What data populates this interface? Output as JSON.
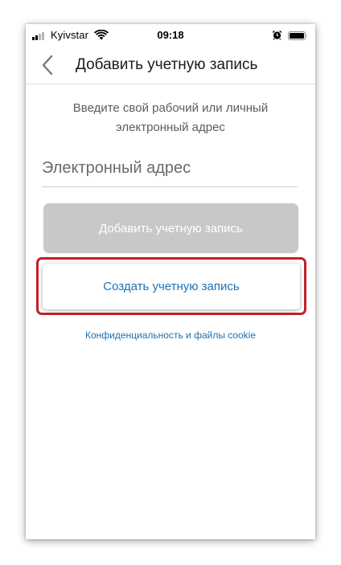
{
  "status_bar": {
    "carrier": "Kyivstar",
    "time": "09:18"
  },
  "nav": {
    "title": "Добавить учетную запись"
  },
  "content": {
    "subtitle": "Введите свой рабочий или личный электронный адрес",
    "email_placeholder": "Электронный адрес",
    "add_button_label": "Добавить учетную запись",
    "create_button_label": "Создать учетную запись",
    "privacy_link": "Конфиденциальность и файлы cookie"
  },
  "colors": {
    "accent": "#1a72b8",
    "disabled_button": "#c8c8c8",
    "highlight_border": "#c12127"
  },
  "icons": {
    "back": "chevron-left-icon",
    "signal": "cell-signal-icon",
    "wifi": "wifi-icon",
    "alarm": "alarm-icon",
    "battery": "battery-icon"
  }
}
